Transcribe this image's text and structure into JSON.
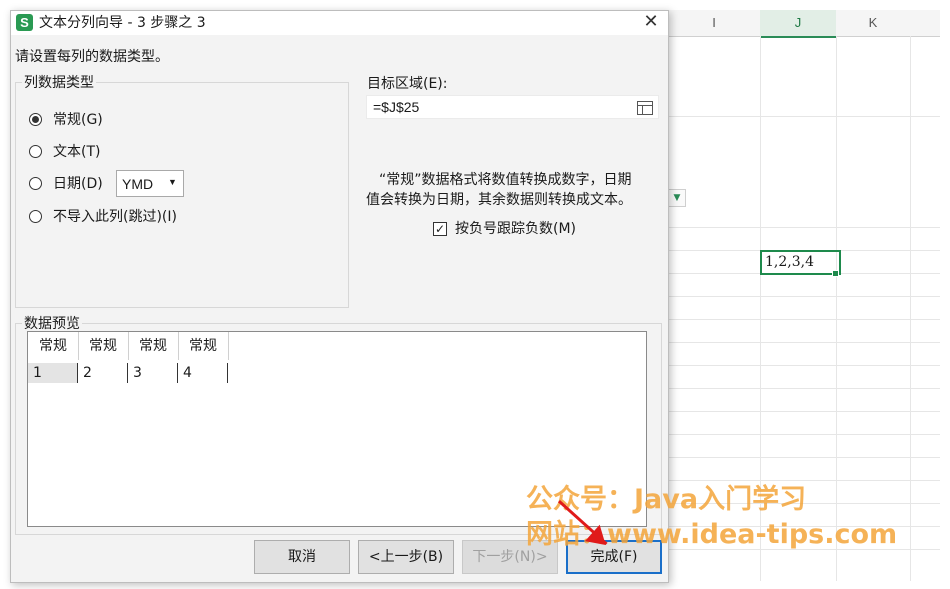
{
  "sheet": {
    "columns": [
      "I",
      "J",
      "K"
    ],
    "active_cell_value": "1,2,3,4"
  },
  "dialog": {
    "app_icon_letter": "S",
    "title": "文本分列向导 - 3 步骤之 3",
    "close_glyph": "✕",
    "instruction": "请设置每列的数据类型。",
    "column_type_group": {
      "title": "列数据类型",
      "options": [
        "常规(G)",
        "文本(T)",
        "日期(D)",
        "不导入此列(跳过)(I)"
      ],
      "selected": "常规(G)",
      "date_format": "YMD",
      "dropdown_arrow": "▼"
    },
    "target": {
      "label": "目标区域(E):",
      "value": "=$J$25"
    },
    "description_line1": "“常规”数据格式将数值转换成数字，日期",
    "description_line2": "值会转换为日期，其余数据则转换成文本。",
    "negative_checkbox": {
      "label": "按负号跟踪负数(M)",
      "checked": true,
      "glyph": "✓"
    },
    "preview": {
      "title": "数据预览",
      "headers": [
        "常规",
        "常规",
        "常规",
        "常规"
      ],
      "row": [
        "1",
        "2",
        "3",
        "4"
      ]
    },
    "buttons": {
      "cancel": "取消",
      "back": "<上一步(B)",
      "next": "下一步(N)>",
      "finish": "完成(F)"
    }
  },
  "watermark": {
    "line1": "公众号：Java入门学习",
    "line2": "网站：www.idea-tips.com"
  },
  "colors": {
    "accent_green": "#1e8a4c",
    "default_button_border": "#1a6fc9",
    "watermark": "#f4a53a",
    "arrow": "#e01a1a"
  }
}
